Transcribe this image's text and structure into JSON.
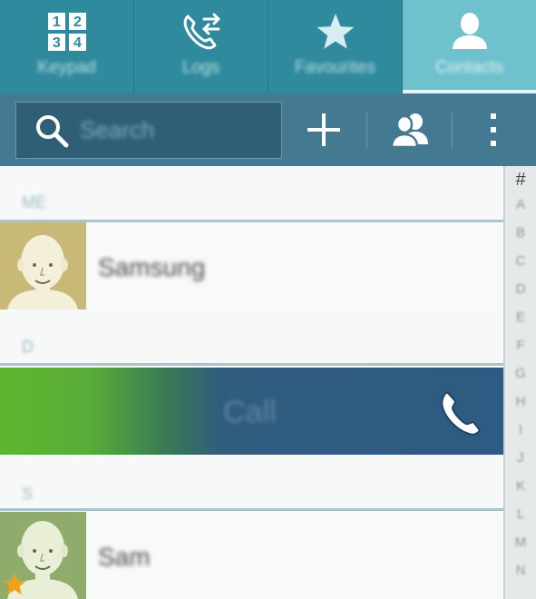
{
  "tabs": [
    {
      "label": "Keypad",
      "icon": "keypad-icon",
      "digits": [
        "1",
        "2",
        "3",
        "4"
      ],
      "active": false
    },
    {
      "label": "Logs",
      "icon": "call-log-icon",
      "active": false
    },
    {
      "label": "Favourites",
      "icon": "star-icon",
      "active": false
    },
    {
      "label": "Contacts",
      "icon": "person-icon",
      "active": true
    }
  ],
  "actionbar": {
    "search_placeholder": "Search",
    "add_icon": "plus-icon",
    "group_icon": "groups-icon",
    "more_icon": "overflow-menu-icon"
  },
  "list": {
    "sections": [
      "ME",
      "D",
      "S"
    ],
    "contacts": [
      {
        "name": "Samsung",
        "favorite": false,
        "avatar": "default-avatar"
      },
      {
        "name": "Sam",
        "favorite": true,
        "avatar": "default-avatar"
      }
    ],
    "swipe_action": {
      "label": "Call",
      "icon": "phone-icon"
    }
  },
  "index": {
    "hash": "#",
    "letters": [
      "A",
      "B",
      "C",
      "D",
      "E",
      "F",
      "G",
      "H",
      "I",
      "J",
      "K",
      "L",
      "M",
      "N"
    ]
  },
  "colors": {
    "tab_bar": "#2f8a9d",
    "tab_active": "#6ec1cd",
    "action_bar": "#437a92",
    "search_field": "#2f5f74",
    "call_green": "#5fb62e",
    "call_blue": "#2e5b83",
    "section_rule": "#a8c5cd"
  }
}
